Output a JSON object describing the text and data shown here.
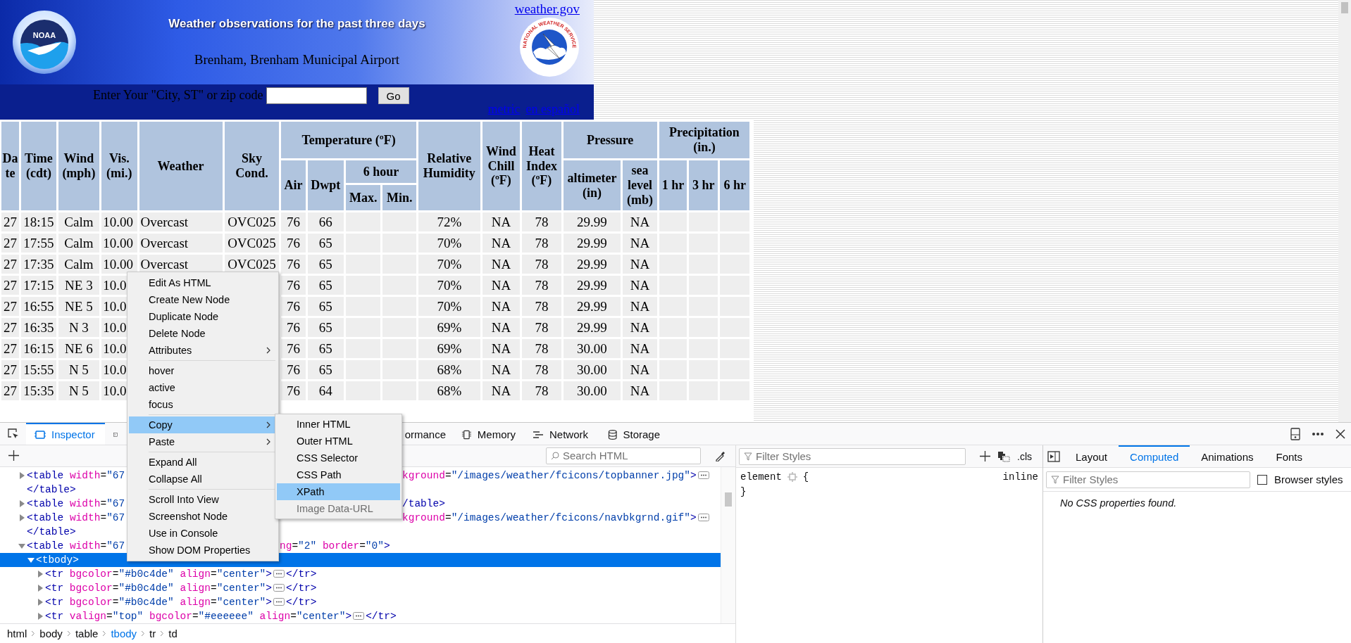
{
  "banner": {
    "title": "Weather observations for the past three days",
    "location": "Brenham, Brenham Municipal Airport",
    "home_link": "weather.gov",
    "left_logo_text": "NOAA",
    "right_logo_text": "NATIONAL WEATHER SERVICE",
    "search_label": "Enter Your \"City, ST\" or zip code",
    "go_button": "Go",
    "links": [
      "metric",
      "en español"
    ]
  },
  "table": {
    "columns": [
      {
        "label": "Date"
      },
      {
        "label": "Time (cdt)"
      },
      {
        "label": "Wind (mph)"
      },
      {
        "label": "Vis. (mi.)"
      },
      {
        "label": "Weather"
      },
      {
        "label": "Sky Cond."
      },
      {
        "label": "Temperature (ºF)",
        "children": [
          {
            "label": "Air"
          },
          {
            "label": "Dwpt"
          },
          {
            "label": "6 hour",
            "children": [
              {
                "label": "Max."
              },
              {
                "label": "Min."
              }
            ]
          }
        ]
      },
      {
        "label": "Relative Humidity"
      },
      {
        "label": "Wind Chill (ºF)"
      },
      {
        "label": "Heat Index (ºF)"
      },
      {
        "label": "Pressure",
        "children": [
          {
            "label": "altimeter (in)"
          },
          {
            "label": "sea level (mb)"
          }
        ]
      },
      {
        "label": "Precipitation (in.)",
        "children": [
          {
            "label": "1 hr"
          },
          {
            "label": "3 hr"
          },
          {
            "label": "6 hr"
          }
        ]
      }
    ],
    "rows": [
      {
        "date": "27",
        "time": "18:15",
        "wind": "Calm",
        "vis": "10.00",
        "weather": "Overcast",
        "sky": "OVC025",
        "air": "76",
        "dwpt": "66",
        "rh": "72%",
        "wind_chill": "NA",
        "heat_index": "78",
        "altimeter": "29.99",
        "sea_level": "NA"
      },
      {
        "date": "27",
        "time": "17:55",
        "wind": "Calm",
        "vis": "10.00",
        "weather": "Overcast",
        "sky": "OVC025",
        "air": "76",
        "dwpt": "65",
        "rh": "70%",
        "wind_chill": "NA",
        "heat_index": "78",
        "altimeter": "29.99",
        "sea_level": "NA"
      },
      {
        "date": "27",
        "time": "17:35",
        "wind": "Calm",
        "vis": "10.00",
        "weather": "Overcast",
        "sky": "OVC025",
        "air": "76",
        "dwpt": "65",
        "rh": "70%",
        "wind_chill": "NA",
        "heat_index": "78",
        "altimeter": "29.99",
        "sea_level": "NA"
      },
      {
        "date": "27",
        "time": "17:15",
        "wind": "NE 3",
        "vis": "10.0",
        "air": "76",
        "dwpt": "65",
        "rh": "70%",
        "wind_chill": "NA",
        "heat_index": "78",
        "altimeter": "29.99",
        "sea_level": "NA"
      },
      {
        "date": "27",
        "time": "16:55",
        "wind": "NE 5",
        "vis": "10.0",
        "air": "76",
        "dwpt": "65",
        "rh": "70%",
        "wind_chill": "NA",
        "heat_index": "78",
        "altimeter": "29.99",
        "sea_level": "NA"
      },
      {
        "date": "27",
        "time": "16:35",
        "wind": "N 3",
        "vis": "10.0",
        "air": "76",
        "dwpt": "65",
        "rh": "69%",
        "wind_chill": "NA",
        "heat_index": "78",
        "altimeter": "29.99",
        "sea_level": "NA"
      },
      {
        "date": "27",
        "time": "16:15",
        "wind": "NE 6",
        "vis": "10.0",
        "air": "76",
        "dwpt": "65",
        "rh": "69%",
        "wind_chill": "NA",
        "heat_index": "78",
        "altimeter": "30.00",
        "sea_level": "NA"
      },
      {
        "date": "27",
        "time": "15:55",
        "wind": "N 5",
        "vis": "10.0",
        "air": "76",
        "dwpt": "65",
        "rh": "68%",
        "wind_chill": "NA",
        "heat_index": "78",
        "altimeter": "30.00",
        "sea_level": "NA"
      },
      {
        "date": "27",
        "time": "15:35",
        "wind": "N 5",
        "vis": "10.0",
        "air": "76",
        "dwpt": "64",
        "rh": "68%",
        "wind_chill": "NA",
        "heat_index": "78",
        "altimeter": "30.00",
        "sea_level": "NA"
      }
    ]
  },
  "devtools": {
    "tabs": [
      {
        "kind": "inspector",
        "label": "Inspector",
        "selected": true
      },
      {
        "kind": "console",
        "selected": false
      },
      {
        "kind": "performance",
        "label": "ormance",
        "selected": false
      },
      {
        "kind": "memory",
        "label": "Memory",
        "selected": false
      },
      {
        "kind": "network",
        "label": "Network",
        "selected": false
      },
      {
        "kind": "storage",
        "label": "Storage",
        "selected": false
      }
    ],
    "markup": {
      "search_placeholder": "Search HTML",
      "tree": [
        {
          "kind": "element",
          "expanded": false,
          "selected": false,
          "left": "<table width=\"67",
          "right": "kground=\"/images/weather/fcicons/topbanner.jpg\">",
          "ellipsis": true,
          "under_submenu": true
        },
        {
          "kind": "close",
          "selected": false,
          "left": "</table>"
        },
        {
          "kind": "element",
          "expanded": false,
          "selected": false,
          "left": "<table width=\"67",
          "right": "/table>",
          "ellipsis": false,
          "under_submenu": true
        },
        {
          "kind": "element",
          "expanded": false,
          "selected": false,
          "left": "<table width=\"67",
          "right": "kground=\"/images/weather/fcicons/navbkgrnd.gif\">",
          "ellipsis": true,
          "under_submenu": true
        },
        {
          "kind": "close",
          "selected": false,
          "left": "</table>"
        },
        {
          "kind": "element",
          "expanded": true,
          "selected": false,
          "left": "<table width=\"67",
          "right": "ng=\"2\" border=\"0\">",
          "ellipsis": false,
          "under_submenu": false,
          "children": [
            {
              "kind": "element",
              "expanded": true,
              "selected": true,
              "left": "<tbody>",
              "ellipsis": false,
              "children": [
                {
                  "kind": "element",
                  "expanded": false,
                  "selected": false,
                  "left": "<tr bgcolor=\"#b0c4de\" align=\"center\">",
                  "ellipsis": true,
                  "tail": "</tr>"
                },
                {
                  "kind": "element",
                  "expanded": false,
                  "selected": false,
                  "left": "<tr bgcolor=\"#b0c4de\" align=\"center\">",
                  "ellipsis": true,
                  "tail": "</tr>"
                },
                {
                  "kind": "element",
                  "expanded": false,
                  "selected": false,
                  "left": "<tr bgcolor=\"#b0c4de\" align=\"center\">",
                  "ellipsis": true,
                  "tail": "</tr>"
                },
                {
                  "kind": "element",
                  "expanded": false,
                  "selected": false,
                  "left": "<tr valign=\"top\" bgcolor=\"#eeeeee\" align=\"center\">",
                  "ellipsis": true,
                  "tail": "</tr>"
                }
              ]
            }
          ]
        }
      ],
      "breadcrumbs": [
        {
          "label": "html",
          "selected": false
        },
        {
          "label": "body",
          "selected": false
        },
        {
          "label": "table",
          "selected": false
        },
        {
          "label": "tbody",
          "selected": true
        },
        {
          "label": "tr",
          "selected": false
        },
        {
          "label": "td",
          "selected": false
        }
      ]
    },
    "rules": {
      "filter_placeholder": "Filter Styles",
      "cls": ".cls",
      "selector": "element",
      "open_brace": "{",
      "close_brace": "}",
      "source": "inline"
    },
    "sidebar": {
      "tabs": [
        {
          "label": "Layout",
          "selected": false
        },
        {
          "label": "Computed",
          "selected": true
        },
        {
          "label": "Animations",
          "selected": false
        },
        {
          "label": "Fonts",
          "selected": false
        }
      ],
      "filter_placeholder": "Filter Styles",
      "browser_styles": {
        "label": "Browser styles",
        "checked": false
      },
      "empty_message": "No CSS properties found."
    }
  },
  "context_menu": {
    "groups": [
      [
        {
          "label": "Edit As HTML",
          "submenu": false,
          "selected": false
        },
        {
          "label": "Create New Node",
          "submenu": false,
          "selected": false
        },
        {
          "label": "Duplicate Node",
          "submenu": false,
          "selected": false
        },
        {
          "label": "Delete Node",
          "submenu": false,
          "selected": false
        },
        {
          "label": "Attributes",
          "submenu": true,
          "selected": false
        }
      ],
      [
        {
          "label": "hover",
          "submenu": false,
          "selected": false
        },
        {
          "label": "active",
          "submenu": false,
          "selected": false
        },
        {
          "label": "focus",
          "submenu": false,
          "selected": false
        }
      ],
      [
        {
          "label": "Copy",
          "submenu": true,
          "selected": true
        },
        {
          "label": "Paste",
          "submenu": true,
          "selected": false
        }
      ],
      [
        {
          "label": "Expand All",
          "submenu": false,
          "selected": false
        },
        {
          "label": "Collapse All",
          "submenu": false,
          "selected": false
        }
      ],
      [
        {
          "label": "Scroll Into View",
          "submenu": false,
          "selected": false
        },
        {
          "label": "Screenshot Node",
          "submenu": false,
          "selected": false
        },
        {
          "label": "Use in Console",
          "submenu": false,
          "selected": false
        },
        {
          "label": "Show DOM Properties",
          "submenu": false,
          "selected": false
        }
      ]
    ],
    "submenu": [
      {
        "label": "Inner HTML",
        "selected": false,
        "disabled": false
      },
      {
        "label": "Outer HTML",
        "selected": false,
        "disabled": false
      },
      {
        "label": "CSS Selector",
        "selected": false,
        "disabled": false
      },
      {
        "label": "CSS Path",
        "selected": false,
        "disabled": false
      },
      {
        "label": "XPath",
        "selected": true,
        "disabled": false
      },
      {
        "label": "Image Data-URL",
        "selected": false,
        "disabled": true
      }
    ]
  }
}
